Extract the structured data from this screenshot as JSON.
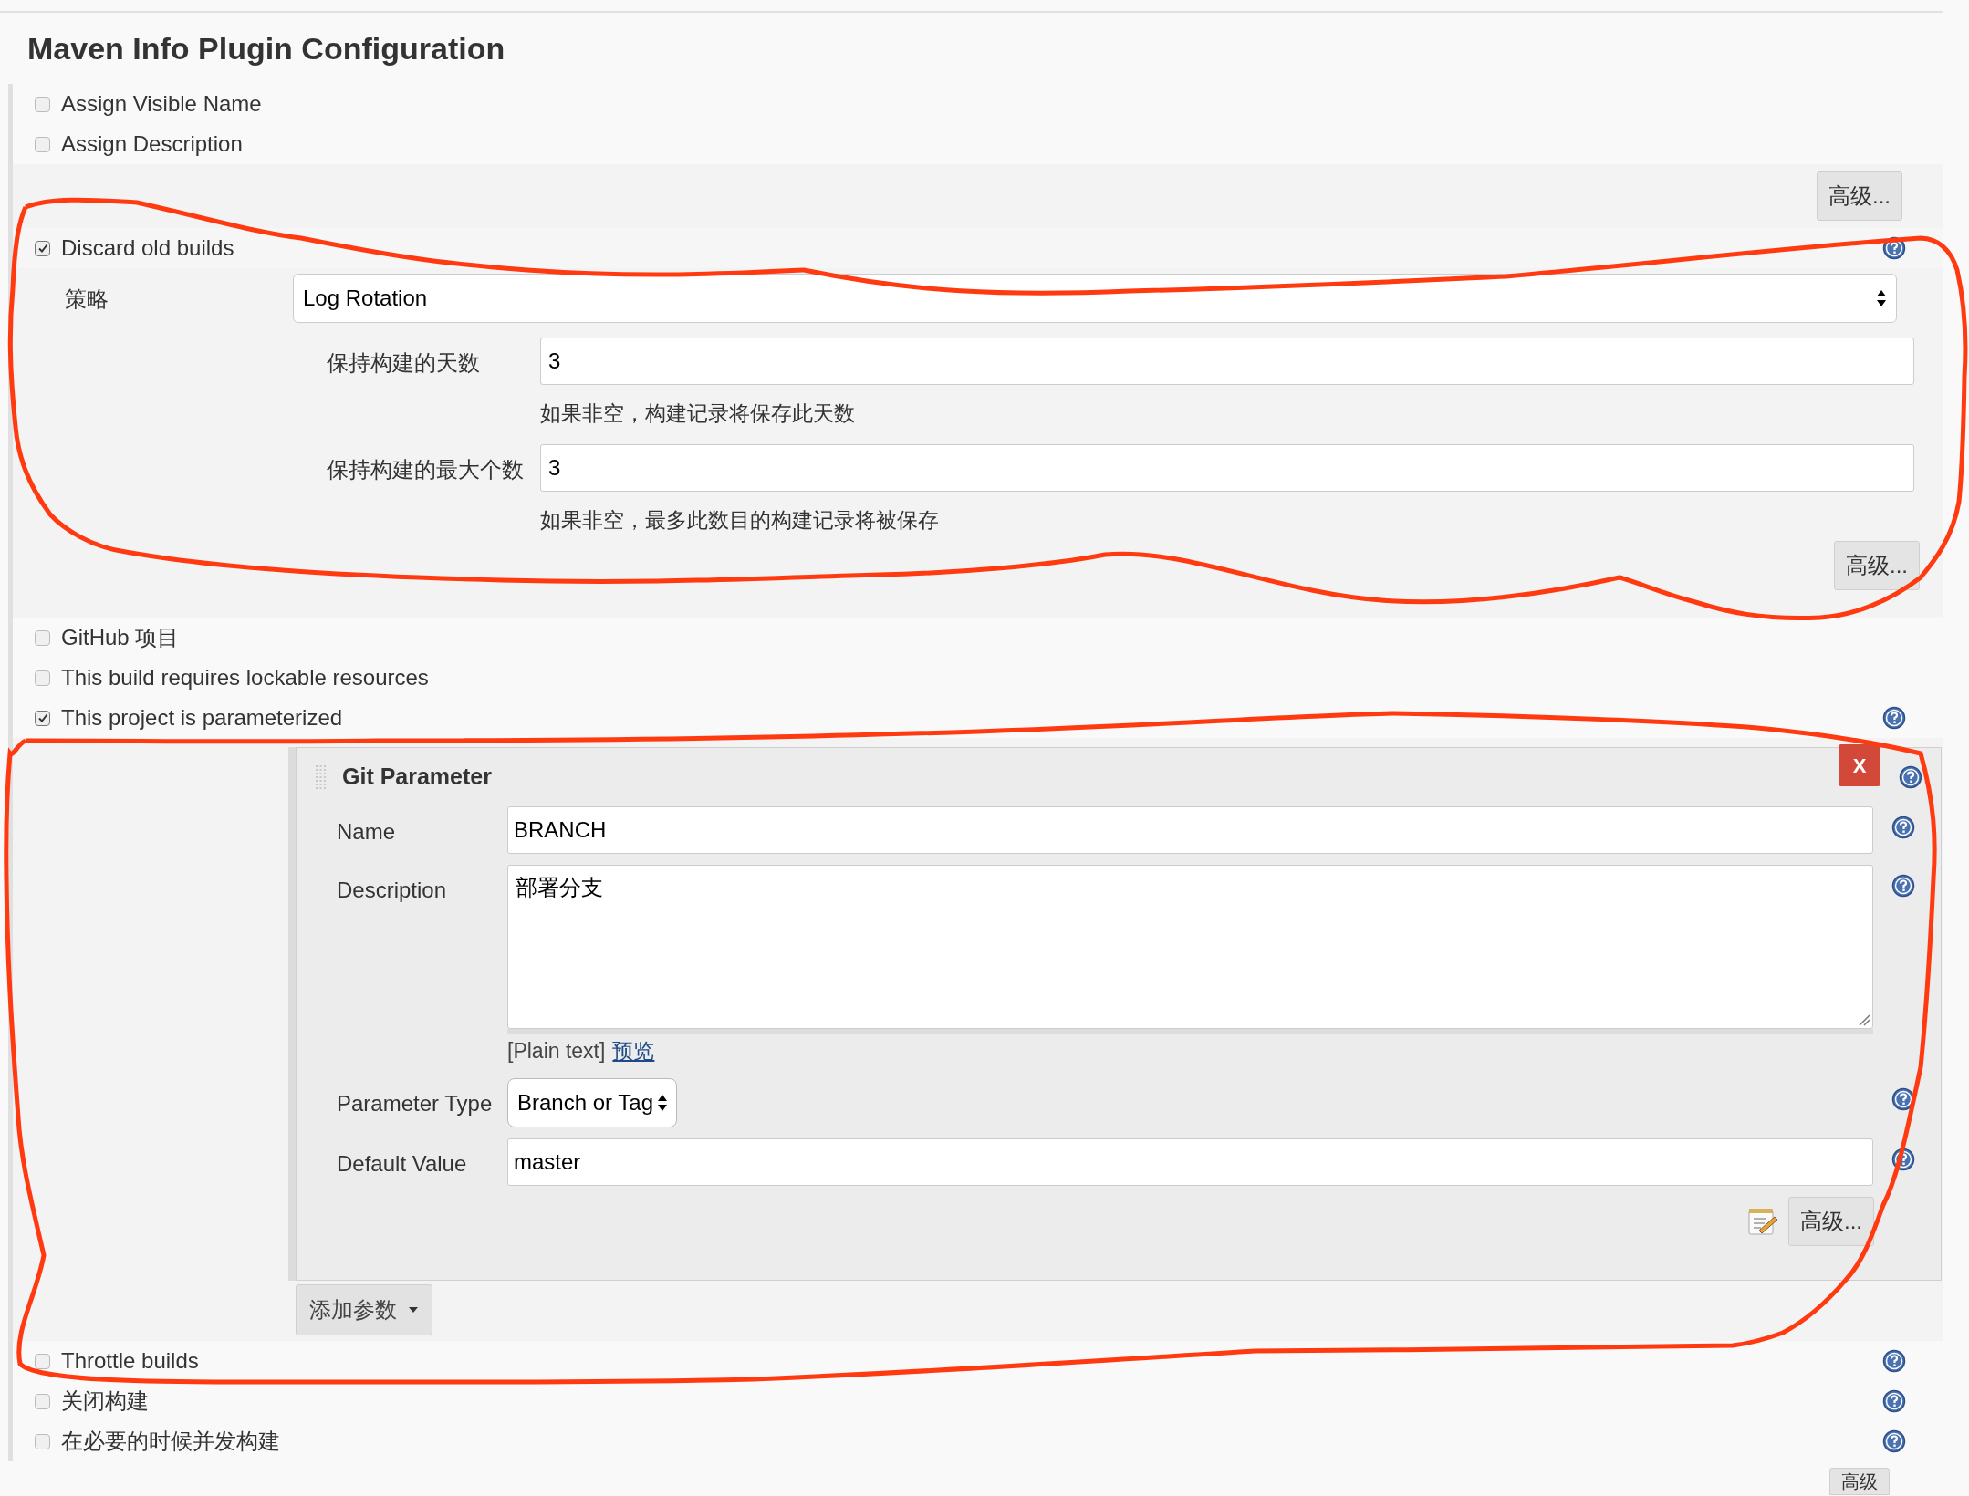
{
  "section_title": "Maven Info Plugin Configuration",
  "options_top": [
    {
      "label": "Assign Visible Name",
      "checked": false
    },
    {
      "label": "Assign Description",
      "checked": false
    }
  ],
  "advanced_button_top": "高级...",
  "discard_old_builds": {
    "label": "Discard old builds",
    "checked": true,
    "strategy_label": "策略",
    "strategy_value": "Log Rotation",
    "fields": [
      {
        "label": "保持构建的天数",
        "value": "3",
        "hint": "如果非空，构建记录将保存此天数"
      },
      {
        "label": "保持构建的最大个数",
        "value": "3",
        "hint": "如果非空，最多此数目的构建记录将被保存"
      }
    ],
    "advanced_button": "高级..."
  },
  "options_middle": [
    {
      "label": "GitHub 项目",
      "checked": false
    },
    {
      "label": "This build requires lockable resources",
      "checked": false
    }
  ],
  "parameterized": {
    "label": "This project is parameterized",
    "checked": true,
    "parameter": {
      "title": "Git Parameter",
      "remove_button": "X",
      "fields": [
        {
          "kind": "text",
          "label": "Name",
          "value": "BRANCH"
        },
        {
          "kind": "textarea",
          "label": "Description",
          "value": "部署分支",
          "format_note": "[Plain text]",
          "preview_link": "预览"
        },
        {
          "kind": "select",
          "label": "Parameter Type",
          "value": "Branch or Tag"
        },
        {
          "kind": "text",
          "label": "Default Value",
          "value": "master"
        }
      ],
      "advanced_button": "高级..."
    },
    "add_button": "添加参数"
  },
  "options_bottom": [
    {
      "label": "Throttle builds",
      "checked": false
    },
    {
      "label": "关闭构建",
      "checked": false
    },
    {
      "label": "在必要的时候并发构建",
      "checked": false
    }
  ],
  "advanced_button_bottom": "高级"
}
